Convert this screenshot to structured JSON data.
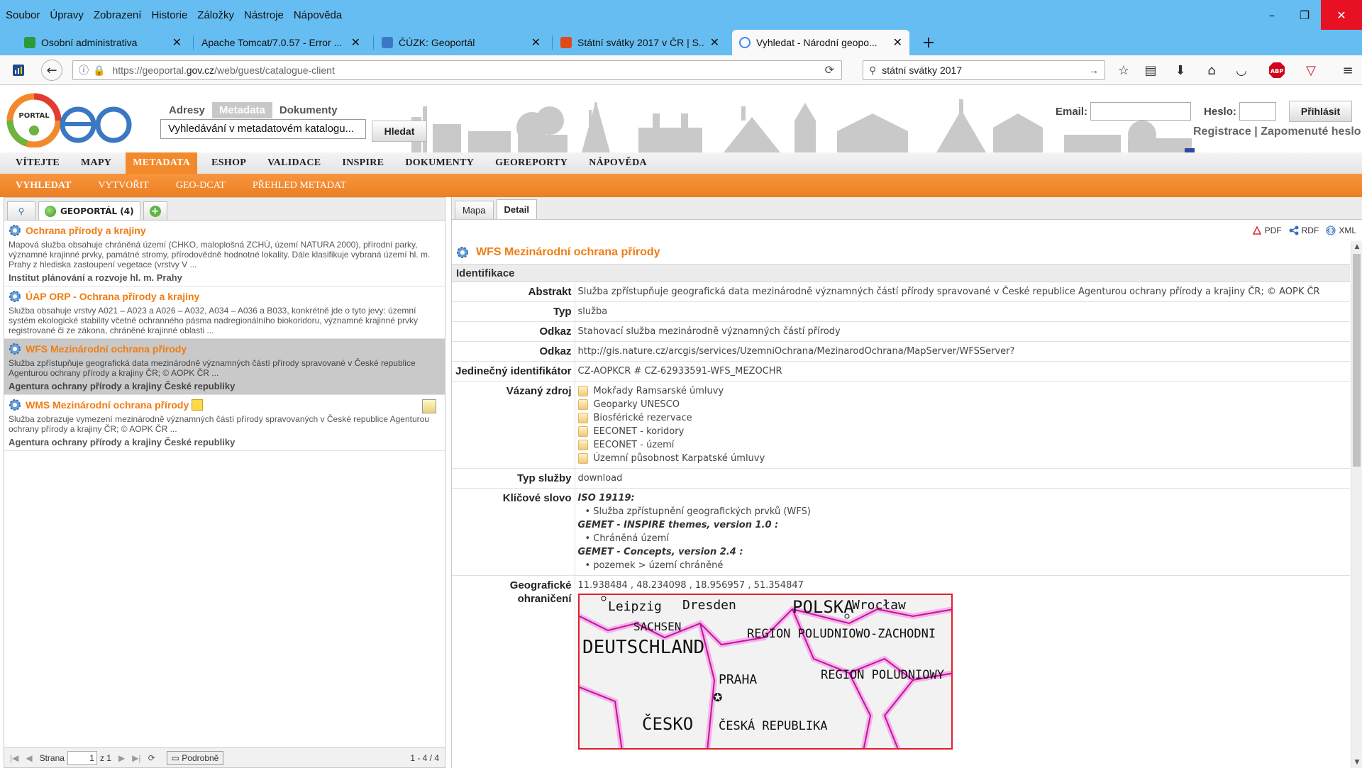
{
  "browser": {
    "menu": [
      "Soubor",
      "Úpravy",
      "Zobrazení",
      "Historie",
      "Záložky",
      "Nástroje",
      "Nápověda"
    ],
    "tabs": [
      {
        "label": "Osobní administrativa",
        "icon_color": "#2c9a3a",
        "active": false
      },
      {
        "label": "Apache Tomcat/7.0.57 - Error ...",
        "icon_color": "",
        "active": false
      },
      {
        "label": "ČÚZK: Geoportál",
        "icon_color": "#3b78c2",
        "active": false
      },
      {
        "label": "Státní svátky 2017 v ČR | S...",
        "icon_color": "#e04a1a",
        "active": false
      },
      {
        "label": "Vyhledat - Národní geopo...",
        "icon_color": "#4285f4",
        "active": true
      }
    ],
    "url_prefix": "https://geoportal.",
    "url_domain": "gov.cz",
    "url_path": "/web/guest/catalogue-client",
    "search_value": "státní svátky 2017",
    "tab_close": "✕",
    "new_tab": "+"
  },
  "site": {
    "header_nav": [
      "Adresy",
      "Metadata",
      "Dokumenty"
    ],
    "header_nav_selected": 1,
    "search_value": "Vyhledávání v metadatovém katalogu...",
    "search_button": "Hledat",
    "email_label": "Email:",
    "password_label": "Heslo:",
    "login_button": "Přihlásit",
    "register_link": "Registrace",
    "separator": "|",
    "forgot_link": "Zapomenuté heslo",
    "main_nav": [
      "VÍTEJTE",
      "MAPY",
      "METADATA",
      "ESHOP",
      "VALIDACE",
      "INSPIRE",
      "DOKUMENTY",
      "GEOREPORTY",
      "NÁPOVĚDA"
    ],
    "main_nav_selected": 2,
    "sub_nav": [
      "VYHLEDAT",
      "VYTVOŘIT",
      "GEO-DCAT",
      "PŘEHLED METADAT"
    ],
    "sub_nav_selected": 0,
    "accent": "#f28a2c",
    "title_color": "#f07c13"
  },
  "left": {
    "tab_label": "GEOPORTÁL (4)",
    "results": [
      {
        "title": "Ochrana přírody a krajiny",
        "desc": "Mapová služba obsahuje chráněná území (CHKO, maloplošná ZCHÚ, území NATURA 2000), přírodní parky, významné krajinné prvky, památné stromy, přírodovědně hodnotné lokality. Dále klasifikuje vybraná území hl. m. Prahy z hlediska zastoupení vegetace (vrstvy V ...",
        "org": "Institut plánování a rozvoje hl. m. Prahy",
        "selected": false
      },
      {
        "title": "ÚAP ORP - Ochrana přírody a krajiny",
        "desc": "Služba obsahuje vrstvy A021 – A023 a A026 – A032, A034 – A036 a B033, konkrétně jde o tyto jevy: územní systém ekologické stability včetně ochranného pásma nadregionálního biokoridoru, významné krajinné prvky registrované či ze zákona, chráněné krajinné oblasti ...",
        "org": "",
        "selected": false
      },
      {
        "title": "WFS Mezinárodní ochrana přírody",
        "desc": "Služba zpřístupňuje geografická data mezinárodně významných částí přírody spravované v České republice Agenturou ochrany přírody a krajiny ČR; © AOPK ČR ...",
        "org": "Agentura ochrany přírody a krajiny České republiky",
        "selected": true
      },
      {
        "title": "WMS Mezinárodní ochrana přírody",
        "desc": "Služba zobrazuje vymezení mezinárodně významných částí přírody spravovaných v České republice Agenturou ochrany přírody a krajiny ČR; © AOPK ČR ...",
        "org": "Agentura ochrany přírody a krajiny České republiky",
        "selected": false
      }
    ],
    "pager": {
      "page_label": "Strana",
      "page_value": "1",
      "of_label": "z 1",
      "detail_button": "Podrobně",
      "count": "1 - 4 / 4"
    }
  },
  "right": {
    "tabs": [
      "Mapa",
      "Detail"
    ],
    "tab_selected": 1,
    "exports": [
      "PDF",
      "RDF",
      "XML"
    ],
    "title": "WFS Mezinárodní ochrana přírody",
    "section": "Identifikace",
    "rows": {
      "abstract_key": "Abstrakt",
      "abstract_val": "Služba zpřístupňuje geografická data mezinárodně významných částí přírody spravované v České republice Agenturou ochrany přírody a krajiny ČR; © AOPK ČR",
      "type_key": "Typ",
      "type_val": "služba",
      "link1_key": "Odkaz",
      "link1_val": "Stahovací služba mezinárodně významných částí přírody",
      "link2_key": "Odkaz",
      "link2_val": "http://gis.nature.cz/arcgis/services/UzemniOchrana/MezinarodOchrana/MapServer/WFSServer?",
      "uid_key": "Jedinečný identifikátor",
      "uid_val": "CZ-AOPKCR # CZ-62933591-WFS_MEZOCHR",
      "bound_key": "Vázaný zdroj",
      "bound_vals": [
        "Mokřady Ramsarské úmluvy",
        "Geoparky UNESCO",
        "Biosférické rezervace",
        "EECONET - koridory",
        "EECONET - území",
        "Územní působnost Karpatské úmluvy"
      ],
      "service_type_key": "Typ služby",
      "service_type_val": "download",
      "keywords_key": "Klíčové slovo",
      "keywords": [
        {
          "thesaurus": "ISO 19119:",
          "items": [
            "• Služba zpřístupnění geografických prvků (WFS)"
          ]
        },
        {
          "thesaurus": "GEMET - INSPIRE themes, version 1.0 :",
          "items": [
            "• Chráněná území"
          ]
        },
        {
          "thesaurus": "GEMET - Concepts, version 2.4 :",
          "items": [
            "• pozemek > území chráněné"
          ]
        }
      ],
      "geo_key": "Geografické ohraničení",
      "geo_val": "11.938484 , 48.234098 , 18.956957 , 51.354847"
    },
    "map_labels": [
      "Leipzig",
      "Dresden",
      "POLSKA",
      "Wrocław",
      "SACHSEN",
      "REGION POLUDNIOWO-ZACHODNI",
      "DEUTSCHLAND",
      "PRAHA",
      "REGION POLUDNIOWY",
      "ČESKO",
      "ČESKÁ REPUBLIKA"
    ]
  }
}
